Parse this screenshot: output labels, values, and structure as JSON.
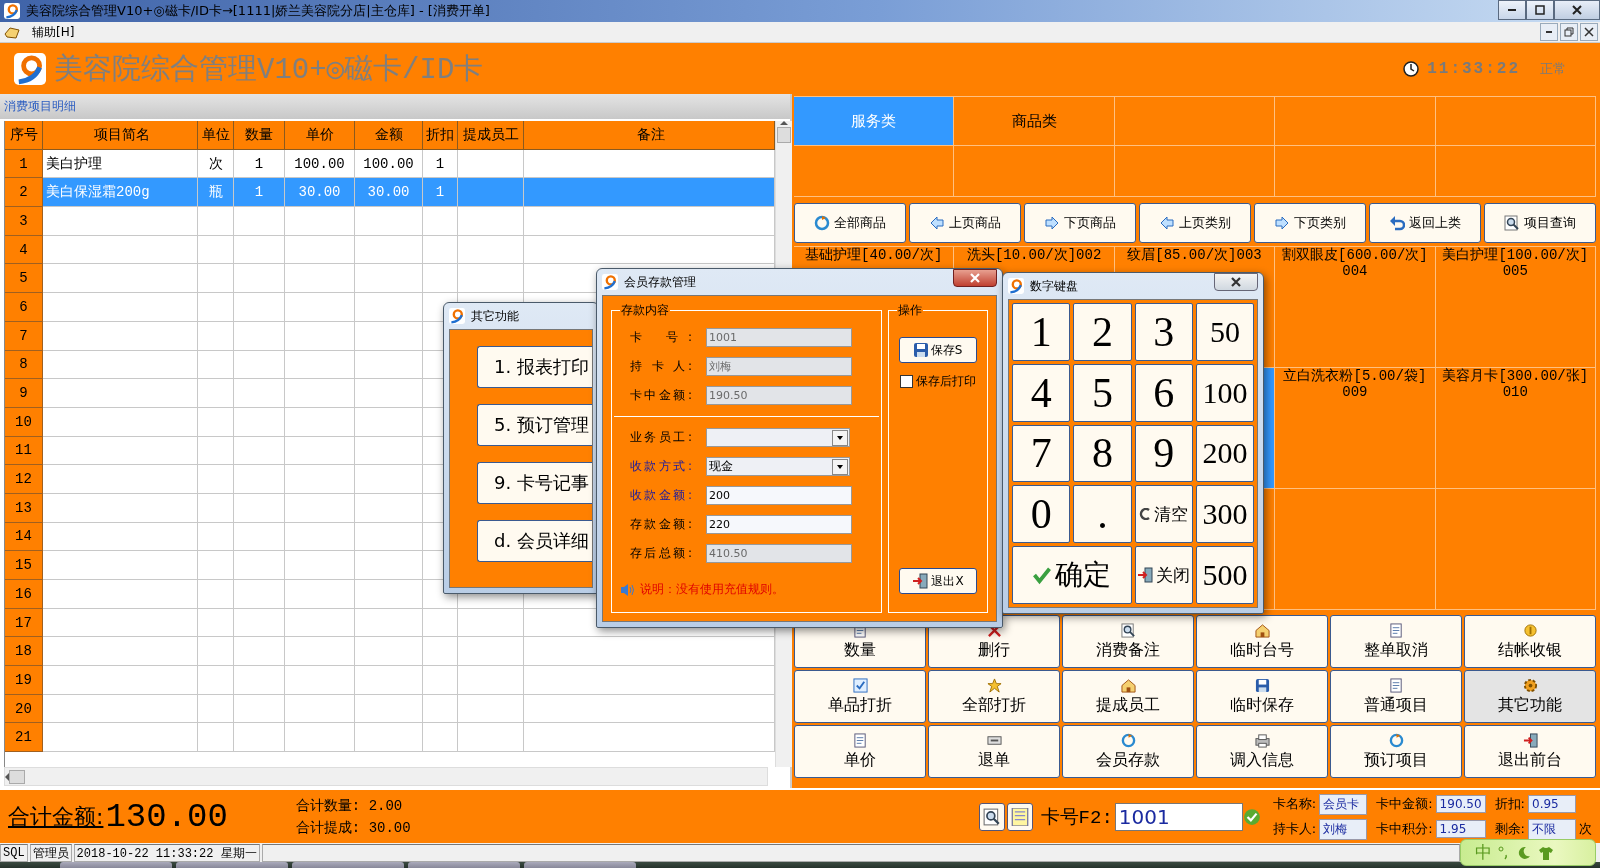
{
  "window": {
    "title": "美容院综合管理V10+◎磁卡/ID卡→[1111|娇兰美容院分店|主仓库] - [消费开单]"
  },
  "menu": [
    {
      "label": "辅助[H]"
    }
  ],
  "header": {
    "title": "美容院综合管理V10+◎磁卡/ID卡",
    "time": "11:33:22",
    "status": "正常"
  },
  "detail": {
    "caption": "消费项目明细",
    "columns": [
      "序号",
      "项目简名",
      "单位",
      "数量",
      "单价",
      "金额",
      "折扣",
      "提成员工",
      "备注"
    ],
    "rows": [
      {
        "no": "1",
        "name": "美白护理",
        "unit": "次",
        "qty": "1",
        "price": "100.00",
        "amount": "100.00",
        "discount": "1",
        "selected": false
      },
      {
        "no": "2",
        "name": "美白保湿霜200g",
        "unit": "瓶",
        "qty": "1",
        "price": "30.00",
        "amount": "30.00",
        "discount": "1",
        "selected": true
      },
      {
        "no": "3",
        "selected": false
      },
      {
        "no": "4",
        "selected": false
      },
      {
        "no": "5",
        "selected": false
      },
      {
        "no": "6",
        "selected": false
      },
      {
        "no": "7",
        "selected": false
      },
      {
        "no": "8",
        "selected": false
      },
      {
        "no": "9",
        "selected": false
      },
      {
        "no": "10",
        "selected": false
      },
      {
        "no": "11",
        "selected": false
      },
      {
        "no": "12",
        "selected": false
      },
      {
        "no": "13",
        "selected": false
      },
      {
        "no": "14",
        "selected": false
      },
      {
        "no": "15",
        "selected": false
      },
      {
        "no": "16",
        "selected": false
      },
      {
        "no": "17",
        "selected": false
      },
      {
        "no": "18",
        "selected": false
      },
      {
        "no": "19",
        "selected": false
      },
      {
        "no": "20",
        "selected": false
      },
      {
        "no": "21",
        "selected": false
      }
    ]
  },
  "categories": [
    {
      "label": "服务类",
      "selected": true
    },
    {
      "label": "商品类",
      "selected": false
    }
  ],
  "nav_buttons": [
    "全部商品",
    "上页商品",
    "下页商品",
    "上页类别",
    "下页类别",
    "返回上类",
    "项目查询"
  ],
  "products": [
    {
      "kind": "tile",
      "name": "基础护理[40.00/次]",
      "selected": false
    },
    {
      "kind": "tile",
      "name": "洗头[10.00/次]",
      "code": "002",
      "selected": false
    },
    {
      "kind": "tile",
      "name": "纹眉[85.00/次]",
      "code": "003",
      "selected": false
    },
    {
      "kind": "tile",
      "name": "割双眼皮[600.00/次]",
      "code": "004",
      "selected": false
    },
    {
      "kind": "tile",
      "name": "美白护理[100.00/次]",
      "code": "005",
      "selected": false
    },
    {
      "kind": "covered"
    },
    {
      "kind": "covered"
    },
    {
      "kind": "tile",
      "selected": true
    },
    {
      "kind": "tile",
      "name": "立白洗衣粉[5.00/袋]",
      "code": "009",
      "selected": false
    },
    {
      "kind": "tile",
      "name": "美容月卡[300.00/张]",
      "code": "010",
      "selected": false
    }
  ],
  "actions": [
    {
      "label": "数量",
      "active": false
    },
    {
      "label": "删行",
      "active": false
    },
    {
      "label": "消费备注",
      "active": false
    },
    {
      "label": "临时台号",
      "active": false
    },
    {
      "label": "整单取消",
      "active": false
    },
    {
      "label": "结帐收银",
      "active": false
    },
    {
      "label": "单品打折",
      "active": false
    },
    {
      "label": "全部打折",
      "active": false
    },
    {
      "label": "提成员工",
      "active": false
    },
    {
      "label": "临时保存",
      "active": false
    },
    {
      "label": "普通项目",
      "active": false
    },
    {
      "label": "其它功能",
      "active": true
    },
    {
      "label": "单价",
      "active": false
    },
    {
      "label": "退单",
      "active": false
    },
    {
      "label": "会员存款",
      "active": false
    },
    {
      "label": "调入信息",
      "active": false
    },
    {
      "label": "预订项目",
      "active": false
    },
    {
      "label": "退出前台",
      "active": false
    }
  ],
  "totals": {
    "amount_label": "合计金额:",
    "amount": "130.00",
    "quantity_label": "合计数量:",
    "quantity": "2.00",
    "commission_label": "合计提成:",
    "commission": "30.00"
  },
  "card": {
    "label": "卡号F2:",
    "value": "1001",
    "fields": [
      {
        "label": "卡名称:",
        "value": "会员卡"
      },
      {
        "label": "卡中金额:",
        "value": "190.50"
      },
      {
        "label": "折扣:",
        "value": "0.95"
      },
      {
        "label": "持卡人:",
        "value": "刘梅"
      },
      {
        "label": "卡中积分:",
        "value": "1.95"
      },
      {
        "label": "剩余:",
        "value": "不限",
        "unit": "次"
      }
    ]
  },
  "status_bar": [
    "SQL",
    "管理员",
    "2018-10-22 11:33:22 星期一"
  ],
  "ime": {
    "label": "中"
  },
  "other_dialog": {
    "title": "其它功能",
    "buttons": [
      "1. 报表打印",
      "5. 预订管理",
      "9. 卡号记事",
      "d. 会员详细"
    ]
  },
  "deposit_dialog": {
    "title": "会员存款管理",
    "group": "存款内容",
    "fields": [
      {
        "label": "卡 号:",
        "value": "1001",
        "kind": "text",
        "disabled": true,
        "highlight": false
      },
      {
        "label": "持 卡 人:",
        "value": "刘梅",
        "kind": "text",
        "disabled": true,
        "highlight": false
      },
      {
        "label": "卡中金额:",
        "value": "190.50",
        "kind": "text",
        "disabled": true,
        "highlight": false
      },
      {
        "label": "业务员工:",
        "kind": "select",
        "highlight": false
      },
      {
        "label": "收款方式:",
        "value": "现金",
        "kind": "select",
        "highlight": true
      },
      {
        "label": "收款金额:",
        "value": "200",
        "kind": "text",
        "disabled": false,
        "highlight": true
      },
      {
        "label": "存款金额:",
        "value": "220",
        "kind": "text",
        "disabled": false,
        "highlight": false
      },
      {
        "label": "存后总额:",
        "value": "410.50",
        "kind": "text",
        "disabled": true,
        "highlight": false
      }
    ],
    "note": "说明：没有使用充值规则。",
    "actions_group": "操作",
    "save": "保存S",
    "print_after_save": {
      "label": "保存后打印",
      "checked": false
    },
    "exit": "退出X"
  },
  "keypad": {
    "title": "数字键盘",
    "keys": [
      {
        "label": "1",
        "kind": "digit"
      },
      {
        "label": "2",
        "kind": "digit"
      },
      {
        "label": "3",
        "kind": "digit"
      },
      {
        "label": "50",
        "kind": "digit"
      },
      {
        "label": "4",
        "kind": "digit"
      },
      {
        "label": "5",
        "kind": "digit"
      },
      {
        "label": "6",
        "kind": "digit"
      },
      {
        "label": "100",
        "kind": "digit"
      },
      {
        "label": "7",
        "kind": "digit"
      },
      {
        "label": "8",
        "kind": "digit"
      },
      {
        "label": "9",
        "kind": "digit"
      },
      {
        "label": "200",
        "kind": "digit"
      },
      {
        "label": "0",
        "kind": "digit"
      },
      {
        "label": ".",
        "kind": "digit"
      },
      {
        "label": "清空",
        "kind": "clear"
      },
      {
        "label": "300",
        "kind": "digit"
      },
      {
        "label": "确定",
        "kind": "confirm"
      },
      {
        "label": "关闭",
        "kind": "close"
      },
      {
        "label": "500",
        "kind": "digit"
      }
    ]
  }
}
